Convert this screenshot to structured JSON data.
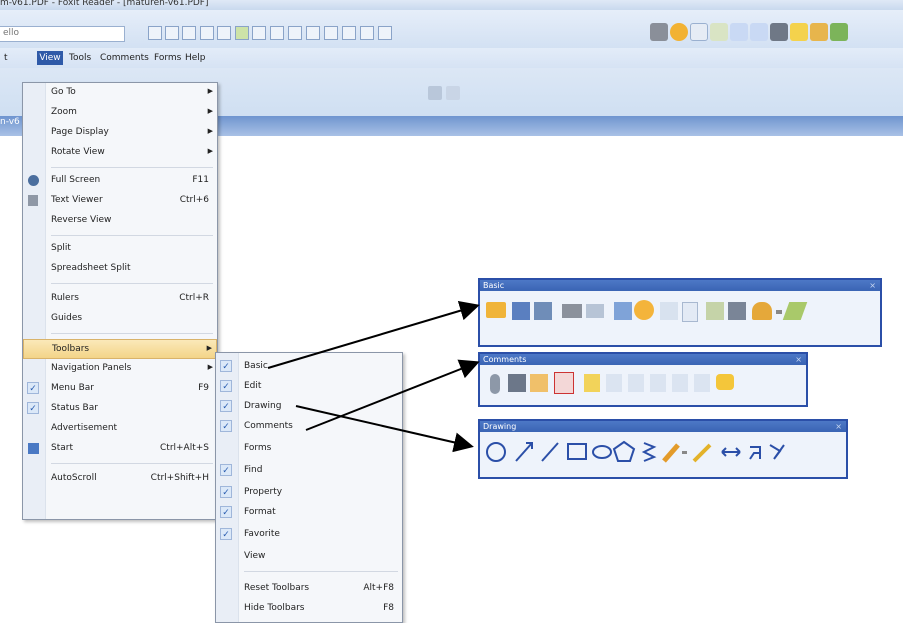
{
  "window": {
    "title": "m-v61.PDF - Foxit Reader - [maturen-v61.PDF]"
  },
  "search": {
    "placeholder": "ello"
  },
  "menubar": {
    "items": [
      "t",
      "View",
      "Tools",
      "Comments",
      "Forms",
      "Help"
    ]
  },
  "tab": {
    "label": "n-v6"
  },
  "view_menu": {
    "items": [
      {
        "label": "Go To",
        "submenu": true
      },
      {
        "label": "Zoom",
        "submenu": true
      },
      {
        "label": "Page Display",
        "submenu": true
      },
      {
        "label": "Rotate View",
        "submenu": true
      },
      {
        "label": "Full Screen",
        "shortcut": "F11",
        "icon": "full-screen-icon"
      },
      {
        "label": "Text Viewer",
        "shortcut": "Ctrl+6",
        "icon": "text-viewer-icon"
      },
      {
        "label": "Reverse View"
      },
      {
        "label": "Split"
      },
      {
        "label": "Spreadsheet Split"
      },
      {
        "label": "Rulers",
        "shortcut": "Ctrl+R"
      },
      {
        "label": "Guides"
      },
      {
        "label": "Toolbars",
        "submenu": true,
        "highlighted": true
      },
      {
        "label": "Navigation Panels",
        "submenu": true
      },
      {
        "label": "Menu Bar",
        "shortcut": "F9",
        "checked": true
      },
      {
        "label": "Status Bar",
        "checked": true
      },
      {
        "label": "Advertisement"
      },
      {
        "label": "Start",
        "shortcut": "Ctrl+Alt+S",
        "icon": "start-icon"
      },
      {
        "label": "AutoScroll",
        "shortcut": "Ctrl+Shift+H"
      }
    ]
  },
  "toolbars_menu": {
    "items": [
      {
        "label": "Basic",
        "checked": true
      },
      {
        "label": "Edit",
        "checked": true
      },
      {
        "label": "Drawing",
        "checked": true
      },
      {
        "label": "Comments",
        "checked": true
      },
      {
        "label": "Forms",
        "checked": false
      },
      {
        "label": "Find",
        "checked": true
      },
      {
        "label": "Property",
        "checked": true
      },
      {
        "label": "Format",
        "checked": true
      },
      {
        "label": "Favorite",
        "checked": true
      },
      {
        "label": "View",
        "checked": false
      },
      {
        "label": "Reset Toolbars",
        "shortcut": "Alt+F8"
      },
      {
        "label": "Hide Toolbars",
        "shortcut": "F8"
      }
    ]
  },
  "floating_toolbars": {
    "basic": {
      "title": "Basic",
      "close": "×"
    },
    "comments": {
      "title": "Comments",
      "close": "×"
    },
    "drawing": {
      "title": "Drawing",
      "close": "×"
    }
  },
  "colors": {
    "accent": "#2b4fa8",
    "menu_highlight": "#f3d488",
    "titlebar": "#c9d9ee"
  }
}
